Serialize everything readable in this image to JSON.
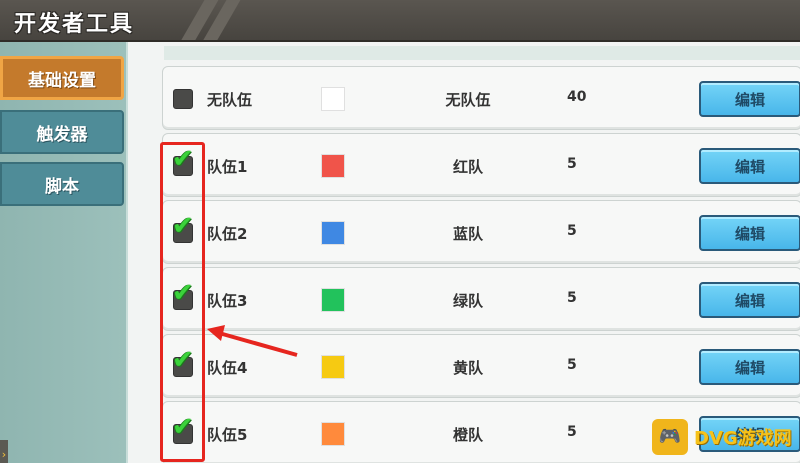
{
  "window": {
    "title": "开发者工具"
  },
  "sidebar": {
    "tabs": [
      {
        "label": "基础设置",
        "active": true
      },
      {
        "label": "触发器",
        "active": false
      },
      {
        "label": "脚本",
        "active": false
      }
    ]
  },
  "teams": {
    "edit_label": "编辑",
    "rows": [
      {
        "name": "无队伍",
        "checked": false,
        "color": "#ffffff",
        "team": "无队伍",
        "count": "40"
      },
      {
        "name": "队伍1",
        "checked": true,
        "color": "#f0544a",
        "team": "红队",
        "count": "5"
      },
      {
        "name": "队伍2",
        "checked": true,
        "color": "#3f88e3",
        "team": "蓝队",
        "count": "5"
      },
      {
        "name": "队伍3",
        "checked": true,
        "color": "#22c25c",
        "team": "绿队",
        "count": "5"
      },
      {
        "name": "队伍4",
        "checked": true,
        "color": "#f6ca12",
        "team": "黄队",
        "count": "5"
      },
      {
        "name": "队伍5",
        "checked": true,
        "color": "#ff8a3c",
        "team": "橙队",
        "count": "5"
      }
    ]
  },
  "annotation": {
    "color": "#e6261f"
  },
  "watermark": {
    "text": "DVG游戏网"
  },
  "icons": {
    "check": "check-icon",
    "collapse": "chevron-right-icon",
    "logo": "gamepad-icon"
  }
}
